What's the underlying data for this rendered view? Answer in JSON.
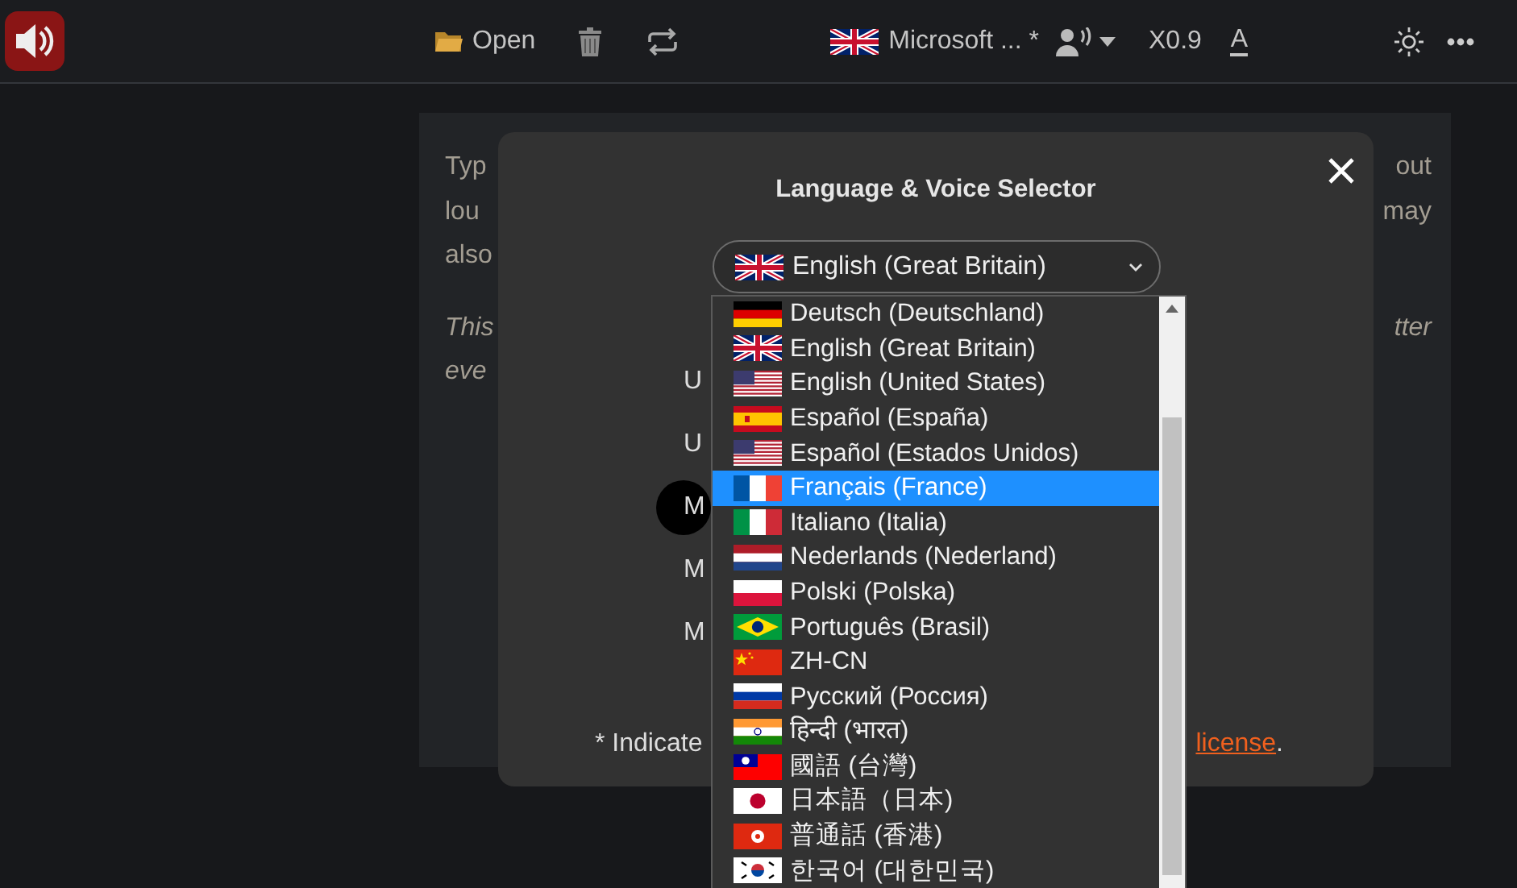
{
  "toolbar": {
    "open_label": "Open",
    "voice_label": "Microsoft ... *",
    "speed": "X0.9",
    "font_label": "A"
  },
  "background": {
    "lines": [
      {
        "left": "Typ",
        "right": "out",
        "kind": "plain"
      },
      {
        "left": "lou",
        "right": "may",
        "kind": "plain"
      },
      {
        "left": "also",
        "kind": "plain"
      },
      {
        "left": "This",
        "right": "tter",
        "kind": "emphasis"
      },
      {
        "left": "eve",
        "kind": "emphasis"
      }
    ]
  },
  "modal": {
    "title": "Language & Voice Selector",
    "select_value": "English (Great Britain)",
    "rows": [
      {
        "text": "U",
        "kind": "plain"
      },
      {
        "text": "U",
        "kind": "plain"
      },
      {
        "text": "M",
        "kind": "badge"
      },
      {
        "text": "M",
        "kind": "plain"
      },
      {
        "text": "M",
        "kind": "plain"
      }
    ],
    "footer": {
      "text": "* Indicate",
      "link": "license",
      "tail": "."
    }
  },
  "dropdown": {
    "items": [
      {
        "label": "Deutsch (Deutschland)",
        "selected": false
      },
      {
        "label": "English (Great Britain)",
        "selected": false
      },
      {
        "label": "English (United States)",
        "selected": false
      },
      {
        "label": "Español (España)",
        "selected": false
      },
      {
        "label": "Español (Estados Unidos)",
        "selected": false
      },
      {
        "label": "Français (France)",
        "selected": true
      },
      {
        "label": "Italiano (Italia)",
        "selected": false
      },
      {
        "label": "Nederlands (Nederland)",
        "selected": false
      },
      {
        "label": "Polski (Polska)",
        "selected": false
      },
      {
        "label": "Português (Brasil)",
        "selected": false
      },
      {
        "label": "ZH-CN",
        "selected": false
      },
      {
        "label": "Русский (Россия)",
        "selected": false
      },
      {
        "label": "हिन्दी (भारत)",
        "selected": false
      },
      {
        "label": "國語 (台灣)",
        "selected": false
      },
      {
        "label": "日本語（日本)",
        "selected": false
      },
      {
        "label": "普通話 (香港)",
        "selected": false
      },
      {
        "label": "한국어 (대한민국)",
        "selected": false
      }
    ]
  }
}
